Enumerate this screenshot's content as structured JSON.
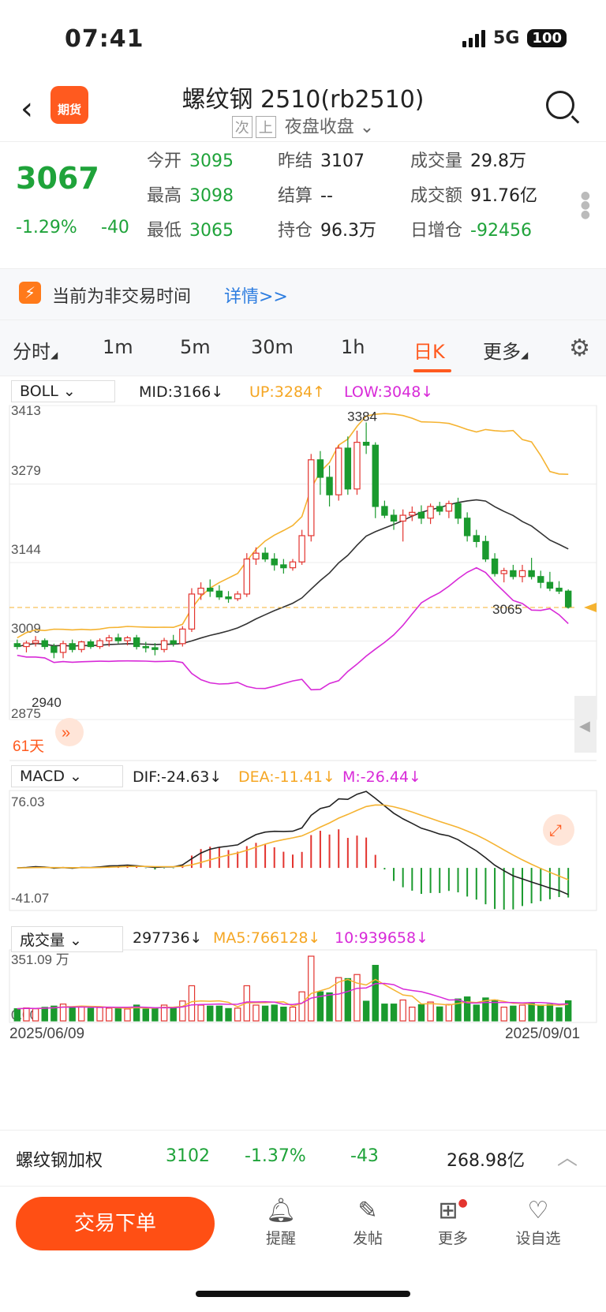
{
  "status": {
    "time": "07:41",
    "network": "5G",
    "battery": "100"
  },
  "header": {
    "title": "螺纹钢 2510(rb2510)",
    "tag1": "次",
    "tag2": "上",
    "session": "夜盘收盘",
    "logo_text": "期货"
  },
  "quote": {
    "price": "3067",
    "change_pct": "-1.29%",
    "change": "-40",
    "stats": [
      {
        "label": "今开",
        "value": "3095",
        "color": "green"
      },
      {
        "label": "昨结",
        "value": "3107",
        "color": "dark"
      },
      {
        "label": "成交量",
        "value": "29.8万",
        "color": "dark"
      },
      {
        "label": "最高",
        "value": "3098",
        "color": "green"
      },
      {
        "label": "结算",
        "value": "--",
        "color": "dark"
      },
      {
        "label": "成交额",
        "value": "91.76亿",
        "color": "dark"
      },
      {
        "label": "最低",
        "value": "3065",
        "color": "green"
      },
      {
        "label": "持仓",
        "value": "96.3万",
        "color": "dark"
      },
      {
        "label": "日增仓",
        "value": "-92456",
        "color": "green"
      }
    ]
  },
  "notice": {
    "text": "当前为非交易时间",
    "link": "详情>>"
  },
  "tabs": [
    "分时",
    "1m",
    "5m",
    "30m",
    "1h",
    "日K",
    "更多"
  ],
  "boll": {
    "selector": "BOLL",
    "mid": "MID:3166↓",
    "up": "UP:3284↑",
    "low": "LOW:3048↓",
    "axis": [
      "3413",
      "3279",
      "3144",
      "3009",
      "2875"
    ],
    "high_label": "3384",
    "low_label": "2940",
    "last_label": "3065",
    "days": "61天"
  },
  "macd": {
    "selector": "MACD",
    "dif": "DIF:-24.63↓",
    "dea": "DEA:-11.41↓",
    "m": "M:-26.44↓",
    "top": "76.03",
    "bottom": "-41.07"
  },
  "vol": {
    "selector": "成交量",
    "vol": "297736↓",
    "ma5": "MA5:766128↓",
    "ma10": "10:939658↓",
    "top": "351.09 万",
    "zero": "0.00"
  },
  "dates": {
    "start": "2025/06/09",
    "end": "2025/09/01"
  },
  "footer": {
    "name": "螺纹钢加权",
    "price": "3102",
    "pct": "-1.37%",
    "chg": "-43",
    "amount": "268.98亿"
  },
  "bottom": {
    "trade": "交易下单",
    "actions": [
      "提醒",
      "发帖",
      "更多",
      "设自选"
    ]
  },
  "chart_data": {
    "type": "candlestick",
    "x_start": "2025/06/09",
    "x_end": "2025/09/01",
    "ylim": [
      2875,
      3413
    ],
    "candles": [
      [
        3005,
        3012,
        2995,
        3000
      ],
      [
        3000,
        3010,
        2990,
        3006
      ],
      [
        3006,
        3018,
        3000,
        3010
      ],
      [
        3010,
        3014,
        2995,
        3000
      ],
      [
        3000,
        3005,
        2980,
        2990
      ],
      [
        2990,
        3010,
        2980,
        3005
      ],
      [
        3005,
        3012,
        2990,
        2995
      ],
      [
        2995,
        3010,
        2990,
        3008
      ],
      [
        3008,
        3012,
        2996,
        3000
      ],
      [
        3000,
        3014,
        2996,
        3010
      ],
      [
        3010,
        3020,
        3000,
        3015
      ],
      [
        3015,
        3022,
        3005,
        3010
      ],
      [
        3010,
        3018,
        3002,
        3015
      ],
      [
        3015,
        3020,
        2995,
        3000
      ],
      [
        3000,
        3008,
        2990,
        2998
      ],
      [
        2998,
        3006,
        2985,
        2995
      ],
      [
        2995,
        3015,
        2990,
        3010
      ],
      [
        3010,
        3020,
        3000,
        3005
      ],
      [
        3005,
        3035,
        3000,
        3030
      ],
      [
        3030,
        3100,
        3025,
        3090
      ],
      [
        3090,
        3110,
        3080,
        3100
      ],
      [
        3100,
        3115,
        3085,
        3095
      ],
      [
        3095,
        3105,
        3080,
        3085
      ],
      [
        3085,
        3095,
        3075,
        3082
      ],
      [
        3082,
        3095,
        3078,
        3090
      ],
      [
        3090,
        3160,
        3085,
        3150
      ],
      [
        3150,
        3170,
        3140,
        3160
      ],
      [
        3160,
        3170,
        3145,
        3150
      ],
      [
        3150,
        3160,
        3130,
        3140
      ],
      [
        3140,
        3150,
        3125,
        3135
      ],
      [
        3135,
        3150,
        3130,
        3145
      ],
      [
        3145,
        3200,
        3140,
        3190
      ],
      [
        3190,
        3330,
        3180,
        3320
      ],
      [
        3320,
        3335,
        3260,
        3290
      ],
      [
        3290,
        3310,
        3240,
        3260
      ],
      [
        3260,
        3345,
        3250,
        3340
      ],
      [
        3340,
        3360,
        3260,
        3270
      ],
      [
        3270,
        3370,
        3260,
        3350
      ],
      [
        3350,
        3384,
        3330,
        3345
      ],
      [
        3345,
        3350,
        3220,
        3240
      ],
      [
        3240,
        3250,
        3220,
        3225
      ],
      [
        3225,
        3235,
        3200,
        3215
      ],
      [
        3215,
        3235,
        3180,
        3225
      ],
      [
        3225,
        3240,
        3215,
        3230
      ],
      [
        3230,
        3242,
        3210,
        3220
      ],
      [
        3220,
        3245,
        3210,
        3240
      ],
      [
        3240,
        3248,
        3225,
        3232
      ],
      [
        3232,
        3250,
        3220,
        3245
      ],
      [
        3245,
        3255,
        3210,
        3220
      ],
      [
        3220,
        3230,
        3180,
        3190
      ],
      [
        3190,
        3200,
        3170,
        3180
      ],
      [
        3180,
        3190,
        3145,
        3150
      ],
      [
        3150,
        3160,
        3120,
        3125
      ],
      [
        3125,
        3135,
        3110,
        3130
      ],
      [
        3130,
        3140,
        3115,
        3120
      ],
      [
        3120,
        3140,
        3110,
        3130
      ],
      [
        3130,
        3152,
        3115,
        3120
      ],
      [
        3120,
        3130,
        3100,
        3110
      ],
      [
        3110,
        3128,
        3095,
        3100
      ],
      [
        3100,
        3112,
        3090,
        3095
      ],
      [
        3095,
        3098,
        3065,
        3067
      ]
    ],
    "macd_top": 76.03,
    "macd_bottom": -41.07,
    "vol_top_wan": 351.09
  }
}
